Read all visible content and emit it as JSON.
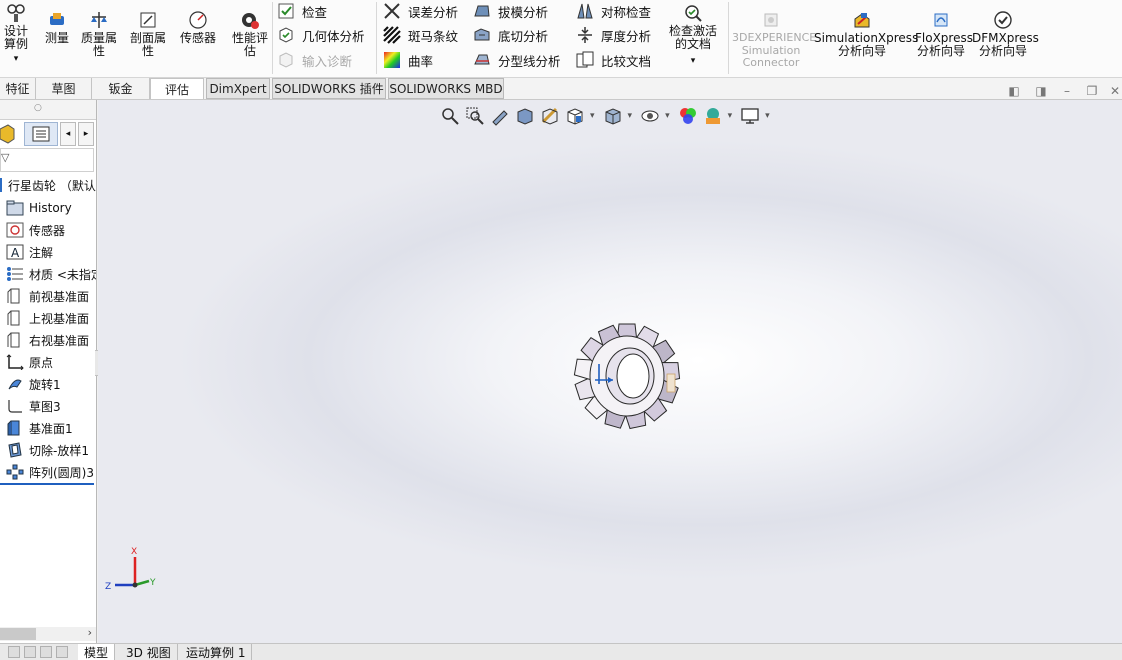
{
  "ribbon": {
    "large_buttons": {
      "design_study": "设计算例",
      "measure": "测量",
      "mass_properties": "质量属性",
      "section_properties": "剖面属性",
      "sensors": "传感器",
      "performance_eval": "性能评估",
      "check_active_doc": "检查激活的文档",
      "sim_connector": "3DEXPERIENCE Simulation Connector",
      "simxpress": "SimulationXpress 分析向导",
      "floxpress": "FloXpress 分析向导",
      "dfmxpress": "DFMXpress 分析向导"
    },
    "small_buttons": {
      "check": "检查",
      "geometry_analysis": "几何体分析",
      "import_diagnostics": "输入诊断",
      "deviation_analysis": "误差分析",
      "zebra_stripes": "斑马条纹",
      "curvature": "曲率",
      "draft_analysis": "拔模分析",
      "undercut_analysis": "底切分析",
      "parting_line_analysis": "分型线分析",
      "symmetry_check": "对称检查",
      "thickness_analysis": "厚度分析",
      "compare_documents": "比较文档"
    }
  },
  "tabs": [
    "特征",
    "草图",
    "钣金",
    "评估",
    "DimXpert",
    "SOLIDWORKS 插件",
    "SOLIDWORKS MBD"
  ],
  "active_tab": "评估",
  "tree": {
    "root": "行星齿轮 （默认<",
    "items": [
      {
        "label": "History",
        "icon": "history-icon"
      },
      {
        "label": "传感器",
        "icon": "sensor-icon"
      },
      {
        "label": "注解",
        "icon": "annotation-icon"
      },
      {
        "label": "材质 <未指定>",
        "icon": "material-icon"
      },
      {
        "label": "前视基准面",
        "icon": "plane-icon"
      },
      {
        "label": "上视基准面",
        "icon": "plane-icon"
      },
      {
        "label": "右视基准面",
        "icon": "plane-icon"
      },
      {
        "label": "原点",
        "icon": "origin-icon"
      },
      {
        "label": "旋转1",
        "icon": "revolve-icon"
      },
      {
        "label": "草图3",
        "icon": "sketch-icon"
      },
      {
        "label": "基准面1",
        "icon": "plane-icon"
      },
      {
        "label": "切除-放样1",
        "icon": "cut-loft-icon"
      },
      {
        "label": "阵列(圆周)3",
        "icon": "circular-pattern-icon"
      }
    ]
  },
  "triad": {
    "x": "X",
    "y": "Y",
    "z": "Z"
  },
  "bottom_tabs": [
    "模型",
    "3D 视图",
    "运动算例 1"
  ],
  "active_bottom_tab": "模型",
  "colors": {
    "accent_blue": "#1f5fbf",
    "gear_face": "#f4f2f6",
    "gear_shadow": "#bdb6c8"
  }
}
